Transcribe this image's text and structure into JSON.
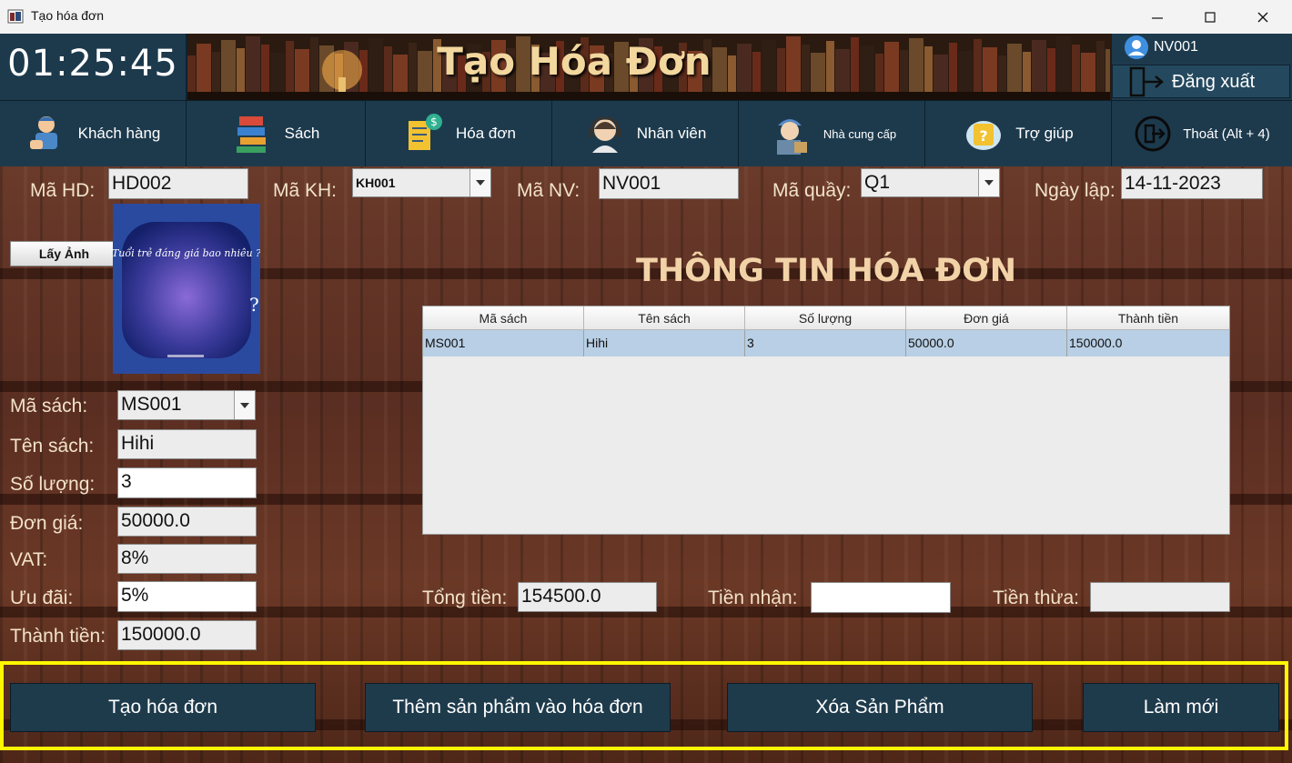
{
  "window": {
    "title": "Tạo hóa đơn"
  },
  "header": {
    "clock": "01:25:45",
    "title": "Tạo Hóa Đơn",
    "user_id": "NV001",
    "logout_label": "Đăng xuất"
  },
  "nav": [
    {
      "label": "Khách hàng",
      "icon": "customer-icon"
    },
    {
      "label": "Sách",
      "icon": "books-icon"
    },
    {
      "label": "Hóa đơn",
      "icon": "invoice-icon"
    },
    {
      "label": "Nhân viên",
      "icon": "employee-icon"
    },
    {
      "label": "Nhà cung cấp",
      "icon": "supplier-icon"
    },
    {
      "label": "Trợ giúp",
      "icon": "help-icon"
    },
    {
      "label": "Thoát (Alt + 4)",
      "icon": "exit-icon"
    }
  ],
  "invoice": {
    "ma_hd_label": "Mã HD:",
    "ma_hd": "HD002",
    "ma_kh_label": "Mã KH:",
    "ma_kh": "KH001",
    "ma_nv_label": "Mã NV:",
    "ma_nv": "NV001",
    "ma_quay_label": "Mã quầy:",
    "ma_quay": "Q1",
    "ngay_lap_label": "Ngày lập:",
    "ngay_lap": "14-11-2023"
  },
  "book": {
    "get_image_label": "Lấy Ảnh",
    "cover_title": "Tuổi trẻ đáng giá bao nhiêu ?",
    "ma_sach_label": "Mã sách:",
    "ma_sach": "MS001",
    "ten_sach_label": "Tên sách:",
    "ten_sach": "Hihi",
    "so_luong_label": "Số lượng:",
    "so_luong": "3",
    "don_gia_label": "Đơn giá:",
    "don_gia": "50000.0",
    "vat_label": "VAT:",
    "vat": "8%",
    "uu_dai_label": "Ưu đãi:",
    "uu_dai": "5%",
    "thanh_tien_label": "Thành tiền:",
    "thanh_tien": "150000.0"
  },
  "details": {
    "heading": "THÔNG TIN HÓA ĐƠN",
    "columns": [
      "Mã sách",
      "Tên sách",
      "Số lượng",
      "Đơn giá",
      "Thành tiền"
    ],
    "rows": [
      [
        "MS001",
        "Hihi",
        "3",
        "50000.0",
        "150000.0"
      ]
    ]
  },
  "totals": {
    "tong_tien_label": "Tổng tiền:",
    "tong_tien": "154500.0",
    "tien_nhan_label": "Tiền nhận:",
    "tien_nhan": "",
    "tien_thua_label": "Tiền thừa:",
    "tien_thua": ""
  },
  "actions": {
    "create": "Tạo hóa đơn",
    "add": "Thêm sản phẩm vào hóa đơn",
    "delete": "Xóa Sản Phẩm",
    "refresh": "Làm mới"
  },
  "colors": {
    "panel": "#1d3a4d",
    "highlight_frame": "#fff700",
    "title_gold": "#f2d79e"
  }
}
